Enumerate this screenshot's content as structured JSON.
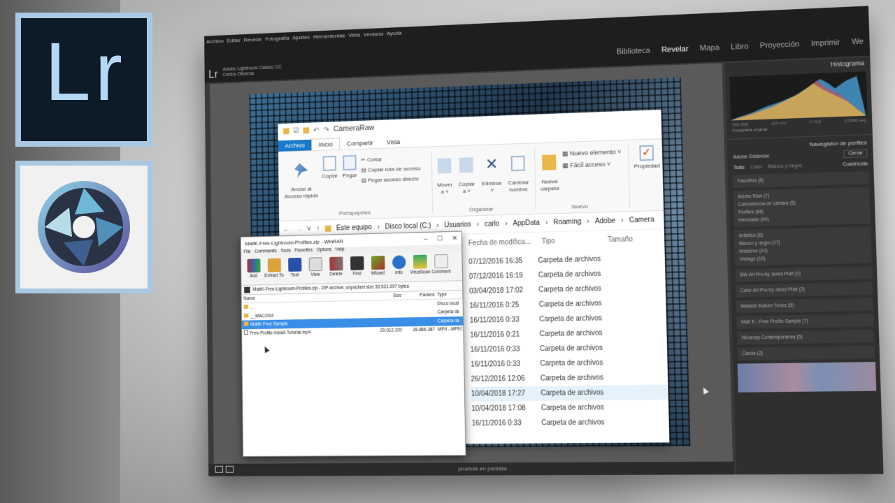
{
  "colors": {
    "lr_blue": "#b5d9f5",
    "lr_dark": "#0d1a27",
    "badge_frame": "#a9c8e4",
    "explorer_accent": "#1979ca",
    "winrar_select": "#3b8ee8"
  },
  "badges": {
    "lr_text": "Lr",
    "aperture_icon": "aperture-shutter-icon"
  },
  "lightroom": {
    "menu": [
      "Archivo",
      "Editar",
      "Revelar",
      "Fotografía",
      "Ajustes",
      "Herramientas",
      "Vista",
      "Ventana",
      "Ayuda"
    ],
    "logo": "Lr",
    "product": "Adobe Lightroom Classic CC",
    "user": "Carlos Oliveras",
    "modules": [
      "Biblioteca",
      "Revelar",
      "Mapa",
      "Libro",
      "Proyección",
      "Imprimir",
      "We"
    ],
    "active_module": "Revelar",
    "bottom_text": "pruebas en pantalla",
    "right_panel": {
      "histogram_title": "Histograma",
      "histo_meta": [
        "ISO 200",
        "115 mm",
        "f / 5,6",
        "1/1000 seg"
      ],
      "original": "Fotografía original",
      "profile_browser": "Navegador de perfiles",
      "profile_name": "Adobe Estándar",
      "close": "Cerrar",
      "tabs": [
        "Todo",
        "Color",
        "Blanco y negro"
      ],
      "grid_label": "Cuadrícula",
      "groups": [
        [
          "Favoritos (6)"
        ],
        [
          "Adobe Raw (7)",
          "Coincidencia de cámara (5)",
          "Perfiles (88)",
          "Heredado (94)"
        ],
        [
          "Artístico (8)",
          "Blanco y negro (17)",
          "Moderno (10)",
          "Vintage (10)"
        ],
        [
          "BW Art Pro by Jared Platt (2)"
        ],
        [
          "Color Art Pro by Jared Platt (2)"
        ],
        [
          "Matiash Nature Tones (5)"
        ],
        [
          "Matt K - Free Profile Sample (7)"
        ],
        [
          "Nicoresy Contemporánea (5)"
        ],
        [
          "Canos (2)"
        ]
      ]
    }
  },
  "explorer": {
    "title": "CameraRaw",
    "tabs": {
      "file": "Archivo",
      "home": "Inicio",
      "share": "Compartir",
      "view": "Vista"
    },
    "ribbon": {
      "pin": "Anclar al\nAcceso rápido",
      "copy": "Copiar",
      "paste": "Pegar",
      "cut": "Cortar",
      "copy_path": "Copiar ruta de acceso",
      "paste_shortcut": "Pegar acceso directo",
      "clipboard_group": "Portapapeles",
      "move": "Mover\na ˅",
      "copy_to": "Copiar\na ˅",
      "delete": "Eliminar\n˅",
      "rename": "Cambiar\nnombre",
      "organize_group": "Organizar",
      "new_folder": "Nueva\ncarpeta",
      "new_item": "Nuevo elemento ˅",
      "easy_access": "Fácil acceso ˅",
      "new_group": "Nuevo",
      "properties": "Propiedad"
    },
    "breadcrumb": [
      "Este equipo",
      "Disco local (C:)",
      "Usuarios",
      "carlo",
      "AppData",
      "Roaming",
      "Adobe",
      "Camera"
    ],
    "columns": {
      "date": "Fecha de modifica...",
      "type": "Tipo",
      "size": "Tamaño"
    },
    "rows": [
      {
        "date": "07/12/2016 16:35",
        "type": "Carpeta de archivos"
      },
      {
        "date": "07/12/2016 16:19",
        "type": "Carpeta de archivos"
      },
      {
        "date": "03/04/2018 17:02",
        "type": "Carpeta de archivos"
      },
      {
        "date": "16/11/2016 0:25",
        "type": "Carpeta de archivos"
      },
      {
        "date": "16/11/2016 0:33",
        "type": "Carpeta de archivos"
      },
      {
        "date": "16/11/2016 0:21",
        "type": "Carpeta de archivos"
      },
      {
        "date": "16/11/2016 0:33",
        "type": "Carpeta de archivos"
      },
      {
        "date": "16/11/2016 0:33",
        "type": "Carpeta de archivos"
      },
      {
        "date": "26/12/2016 12:06",
        "type": "Carpeta de archivos"
      },
      {
        "date": "10/04/2018 17:27",
        "type": "Carpeta de archivos"
      },
      {
        "date": "10/04/2018 17:08",
        "type": "Carpeta de archivos"
      },
      {
        "date": "16/11/2016 0:33",
        "type": "Carpeta de archivos"
      }
    ],
    "highlight_row": 9
  },
  "winrar": {
    "title": "MattK-Free-Lightroom-Profiles.zip - WinRAR",
    "menu": [
      "File",
      "Commands",
      "Tools",
      "Favorites",
      "Options",
      "Help"
    ],
    "toolbar": [
      "Add",
      "Extract To",
      "Test",
      "View",
      "Delete",
      "Find",
      "Wizard",
      "Info",
      "VirusScan",
      "Comment"
    ],
    "path": "MattK-Free-Lightroom-Profiles.zip - ZIP archive, unpacked size 30.521.097 bytes",
    "headers": {
      "name": "Name",
      "size": "Size",
      "packed": "Packed",
      "type": "Type"
    },
    "rows": [
      {
        "name": "..",
        "size": "",
        "packed": "",
        "type": "Disco local"
      },
      {
        "name": "__MACOSX",
        "size": "",
        "packed": "",
        "type": "Carpeta de"
      },
      {
        "name": "MattK Free Sample",
        "size": "",
        "packed": "",
        "type": "Carpeta de"
      },
      {
        "name": "Free-Profile-Install-Tutorial.mp4",
        "size": "29.012.220",
        "packed": "28.886.387",
        "type": "MP4 - MPEG"
      }
    ],
    "selected_row": 2
  }
}
